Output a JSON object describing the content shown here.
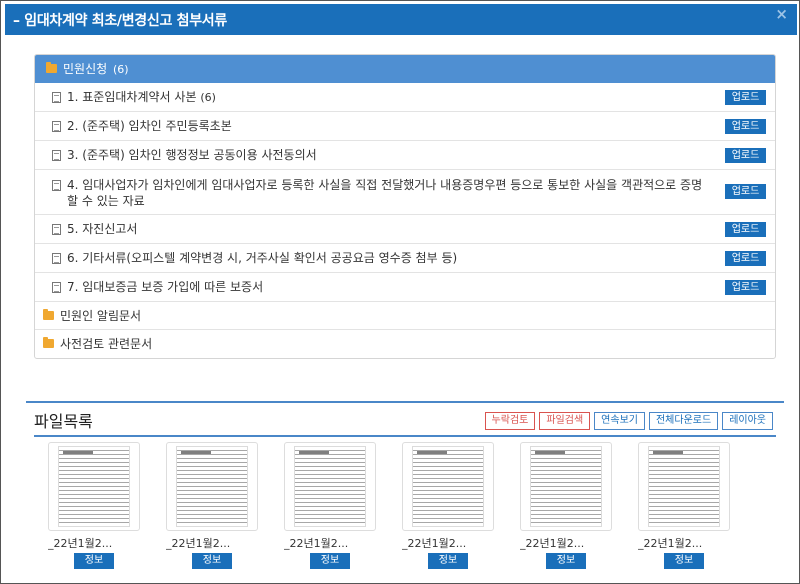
{
  "window": {
    "title": "– 임대차계약 최초/변경신고 첨부서류",
    "close_glyph": "×"
  },
  "panel": {
    "header_label": "민원신청",
    "header_count": "(6)",
    "upload_label": "업로드",
    "items": [
      {
        "label": "1. 표준임대차계약서 사본",
        "count": "(6)"
      },
      {
        "label": "2. (준주택) 임차인 주민등록초본",
        "count": ""
      },
      {
        "label": "3. (준주택) 임차인 행정정보 공동이용 사전동의서",
        "count": ""
      },
      {
        "label": "4. 임대사업자가 임차인에게 임대사업자로 등록한 사실을 직접 전달했거나 내용증명우편 등으로 통보한 사실을 객관적으로 증명할 수 있는 자료",
        "count": ""
      },
      {
        "label": "5. 자진신고서",
        "count": ""
      },
      {
        "label": "6. 기타서류(오피스텔 계약변경 시, 거주사실 확인서 공공요금 영수증 첨부 등)",
        "count": ""
      },
      {
        "label": "7. 임대보증금 보증 가입에 따른 보증서",
        "count": ""
      }
    ],
    "folders": [
      "민원인 알림문서",
      "사전검토 관련문서"
    ]
  },
  "files": {
    "title": "파일목록",
    "buttons": [
      "누락검토",
      "파일검색",
      "연속보기",
      "전체다운로드",
      "레이아웃"
    ],
    "items": [
      {
        "name": "_22년1월2...",
        "info": "정보"
      },
      {
        "name": "_22년1월2...",
        "info": "정보"
      },
      {
        "name": "_22년1월2...",
        "info": "정보"
      },
      {
        "name": "_22년1월2...",
        "info": "정보"
      },
      {
        "name": "_22년1월2...",
        "info": "정보"
      },
      {
        "name": "_22년1월2...",
        "info": "정보"
      }
    ]
  },
  "colors": {
    "accent": "#1a6fba",
    "panel_header": "#4f8fd2",
    "folder": "#f0a830",
    "warning_button": "#d9534f"
  }
}
